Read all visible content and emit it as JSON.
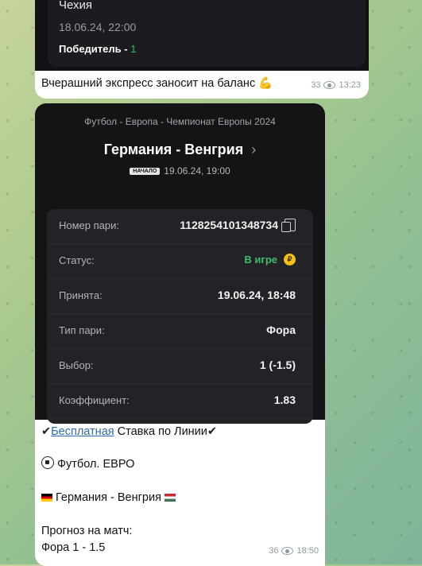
{
  "top_message": {
    "card_country": "Чехия",
    "card_datetime": "18.06.24, 22:00",
    "card_winner_label": "Победитель -",
    "card_winner_value": "1",
    "caption": "Вчерашний экспресс заносит на баланс 💪",
    "views": "33",
    "time": "13:23"
  },
  "bet_screenshot": {
    "breadcrumb": "Футбол - Европа - Чемпионат Европы 2024",
    "match_title": "Германия - Венгрия",
    "start_badge": "НАЧАЛО",
    "start_datetime": "19.06.24, 19:00",
    "rows": [
      {
        "label": "Номер пари:",
        "value": "1128254101348734"
      },
      {
        "label": "Статус:",
        "value": "В игре"
      },
      {
        "label": "Принята:",
        "value": "19.06.24, 18:48"
      },
      {
        "label": "Тип пари:",
        "value": "Фора"
      },
      {
        "label": "Выбор:",
        "value": "1 (-1.5)"
      },
      {
        "label": "Коэффициент:",
        "value": "1.83"
      }
    ],
    "coin_symbol": "₽"
  },
  "post": {
    "line1_check_left": "✔",
    "line1_link": "Бесплатная",
    "line1_rest": " Ставка по Линии",
    "line1_check_right": "✔",
    "line2": "Футбол. ЕВРО",
    "line3": "Германия - Венгрия",
    "line4": "Прогноз на матч:",
    "line5": "Фора 1 - 1.5",
    "views": "36",
    "time": "18:50"
  },
  "colors": {
    "accent_green": "#3bbf6a",
    "link": "#2b6cb0",
    "coin": "#f3c018"
  }
}
